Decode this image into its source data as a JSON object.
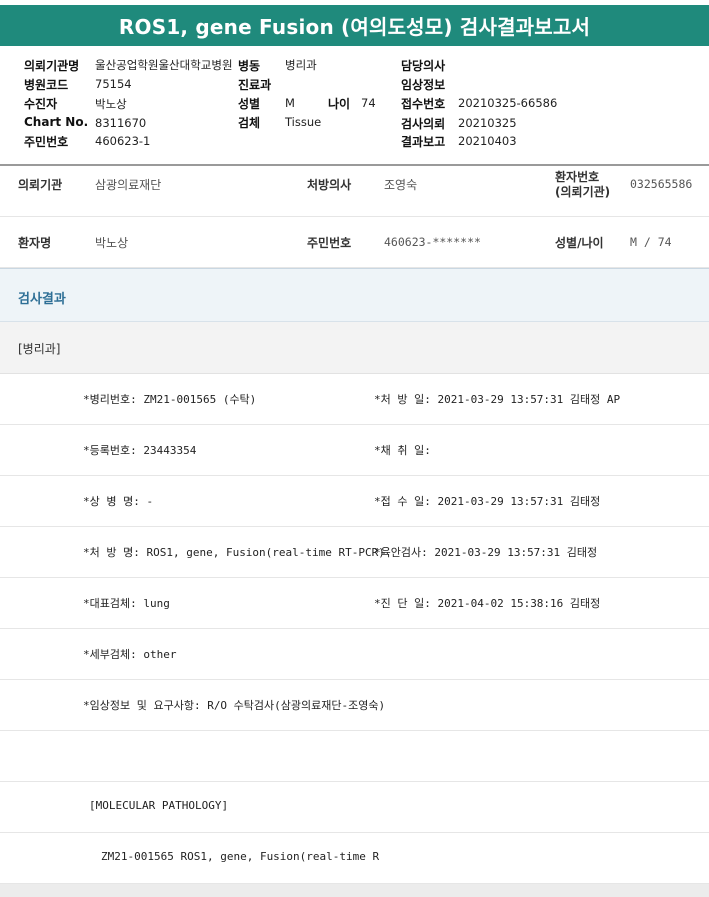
{
  "report": {
    "title": "ROS1, gene Fusion (여의도성모) 검사결과보고서"
  },
  "header": {
    "col1": [
      {
        "label": "의뢰기관명",
        "value": "울산공업학원울산대학교병원"
      },
      {
        "label": "병원코드",
        "value": "75154"
      },
      {
        "label": "수진자",
        "value": "박노상"
      },
      {
        "label": "Chart No.",
        "value": "8311670"
      },
      {
        "label": "주민번호",
        "value": "460623-1"
      }
    ],
    "col2": [
      {
        "label": "병동",
        "value": "병리과"
      },
      {
        "label": "진료과",
        "value": ""
      },
      {
        "label": "성별",
        "value": "M"
      },
      {
        "label": "검체",
        "value": "Tissue"
      }
    ],
    "age": {
      "label": "나이",
      "value": "74"
    },
    "col3": [
      {
        "label": "담당의사",
        "value": ""
      },
      {
        "label": "임상정보",
        "value": ""
      },
      {
        "label": "접수번호",
        "value": "20210325-66586"
      },
      {
        "label": "검사의뢰",
        "value": "20210325"
      },
      {
        "label": "결과보고",
        "value": "20210403"
      }
    ]
  },
  "info": {
    "org_label": "의뢰기관",
    "org_value": "삼광의료재단",
    "doctor_label": "처방의사",
    "doctor_value": "조영숙",
    "patno_label_1": "환자번호",
    "patno_label_2": "(의뢰기관)",
    "patno_value": "032565586",
    "patient_label": "환자명",
    "patient_value": "박노상",
    "ssn_label": "주민번호",
    "ssn_value": "460623-*******",
    "sexage_label": "성별/나이",
    "sexage_value": "M / 74"
  },
  "result": {
    "section_title": "검사결과",
    "dept": "[병리과]",
    "rows": [
      {
        "left": "*병리번호: ZM21-001565 (수탁)",
        "right": "*처 방 일: 2021-03-29 13:57:31  김태정 AP"
      },
      {
        "left": "*등록번호: 23443354",
        "right": "*채 취 일:"
      },
      {
        "left": "*상 병 명: -",
        "right": "*접 수 일: 2021-03-29 13:57:31  김태정"
      },
      {
        "left": "*처 방 명: ROS1, gene, Fusion(real-time RT-PCR)",
        "right": "*육안검사: 2021-03-29 13:57:31  김태정"
      },
      {
        "left": "*대표검체: lung",
        "right": "*진 단 일: 2021-04-02 15:38:16  김태정"
      },
      {
        "left": "*세부검체: other",
        "right": ""
      },
      {
        "left": "*임상정보 및 요구사항: R/O 수탁검사(삼광의료재단-조영숙)",
        "right": ""
      }
    ],
    "molecular_header": "[MOLECULAR PATHOLOGY]",
    "molecular_line": "ZM21-001565     ROS1, gene, Fusion(real-time R"
  }
}
